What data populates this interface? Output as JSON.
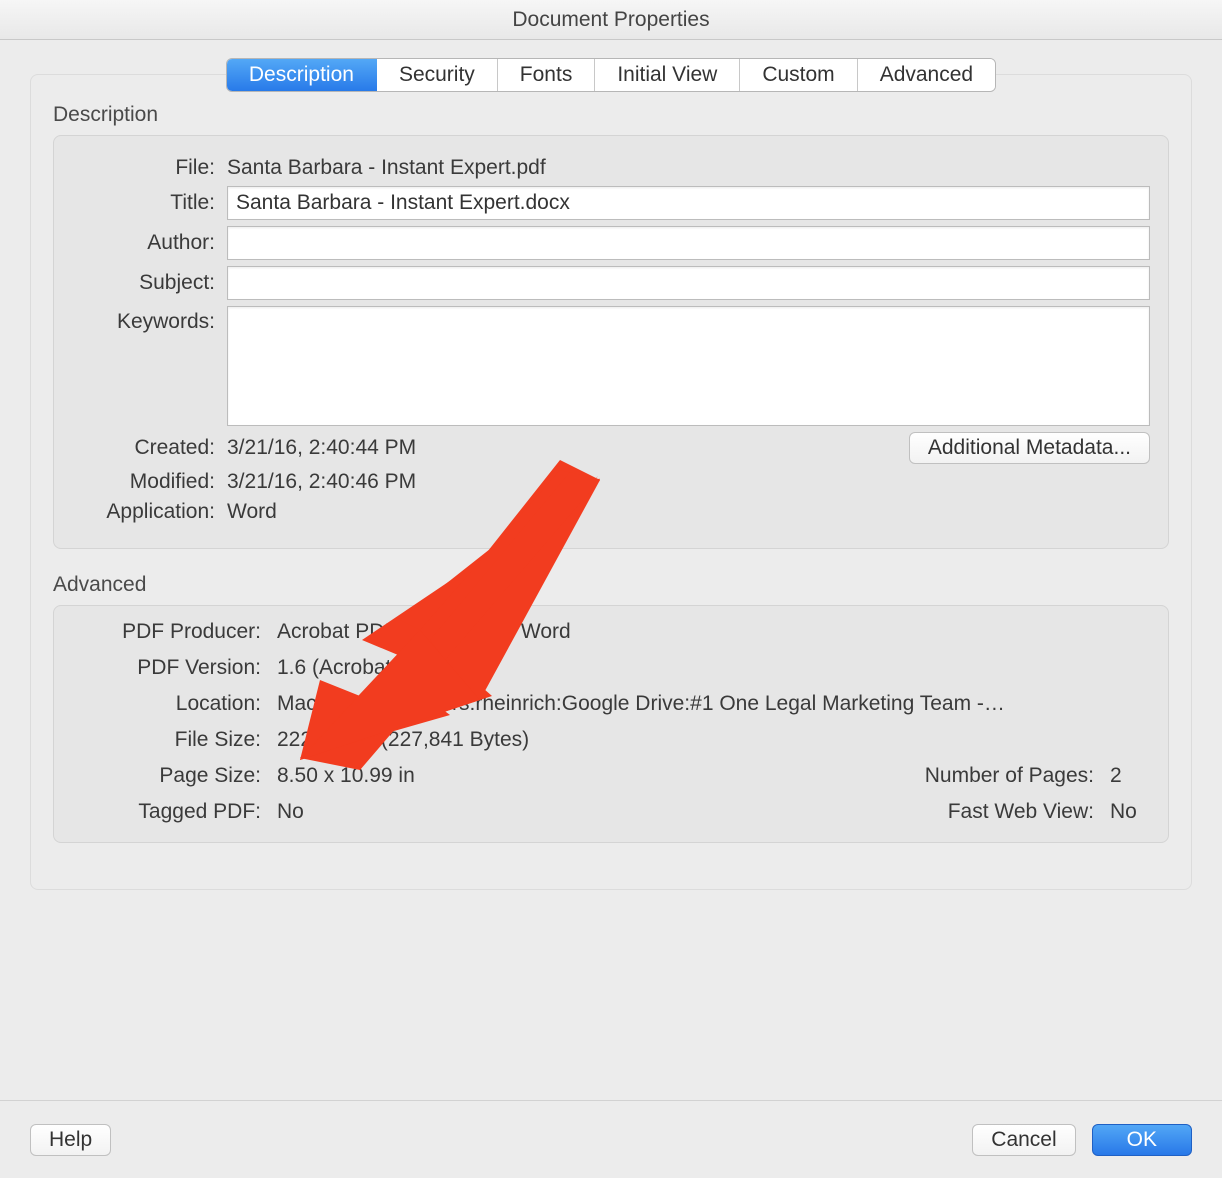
{
  "window": {
    "title": "Document Properties"
  },
  "tabs": {
    "items": [
      "Description",
      "Security",
      "Fonts",
      "Initial View",
      "Custom",
      "Advanced"
    ],
    "active_index": 0
  },
  "description": {
    "section_title": "Description",
    "labels": {
      "file": "File:",
      "title": "Title:",
      "author": "Author:",
      "subject": "Subject:",
      "keywords": "Keywords:",
      "created": "Created:",
      "modified": "Modified:",
      "application": "Application:"
    },
    "file": "Santa Barbara - Instant Expert.pdf",
    "title": "Santa Barbara - Instant Expert.docx",
    "author": "",
    "subject": "",
    "keywords": "",
    "created": "3/21/16, 2:40:44 PM",
    "modified": "3/21/16, 2:40:46 PM",
    "application": "Word",
    "additional_metadata_button": "Additional Metadata..."
  },
  "advanced": {
    "section_title": "Advanced",
    "labels": {
      "pdf_producer": "PDF Producer:",
      "pdf_version": "PDF Version:",
      "location": "Location:",
      "file_size": "File Size:",
      "page_size": "Page Size:",
      "number_of_pages": "Number of Pages:",
      "tagged_pdf": "Tagged PDF:",
      "fast_web_view": "Fast Web View:"
    },
    "pdf_producer": "Acrobat PDFMaker 15 for Word",
    "pdf_version": "1.6 (Acrobat 7.x)",
    "location": "Macintosh HD:Users:rheinrich:Google Drive:#1 One Legal Marketing Team -…",
    "file_size": "222.50 KB (227,841 Bytes)",
    "page_size": "8.50 x 10.99 in",
    "number_of_pages": "2",
    "tagged_pdf": "No",
    "fast_web_view": "No"
  },
  "footer": {
    "help": "Help",
    "cancel": "Cancel",
    "ok": "OK"
  }
}
